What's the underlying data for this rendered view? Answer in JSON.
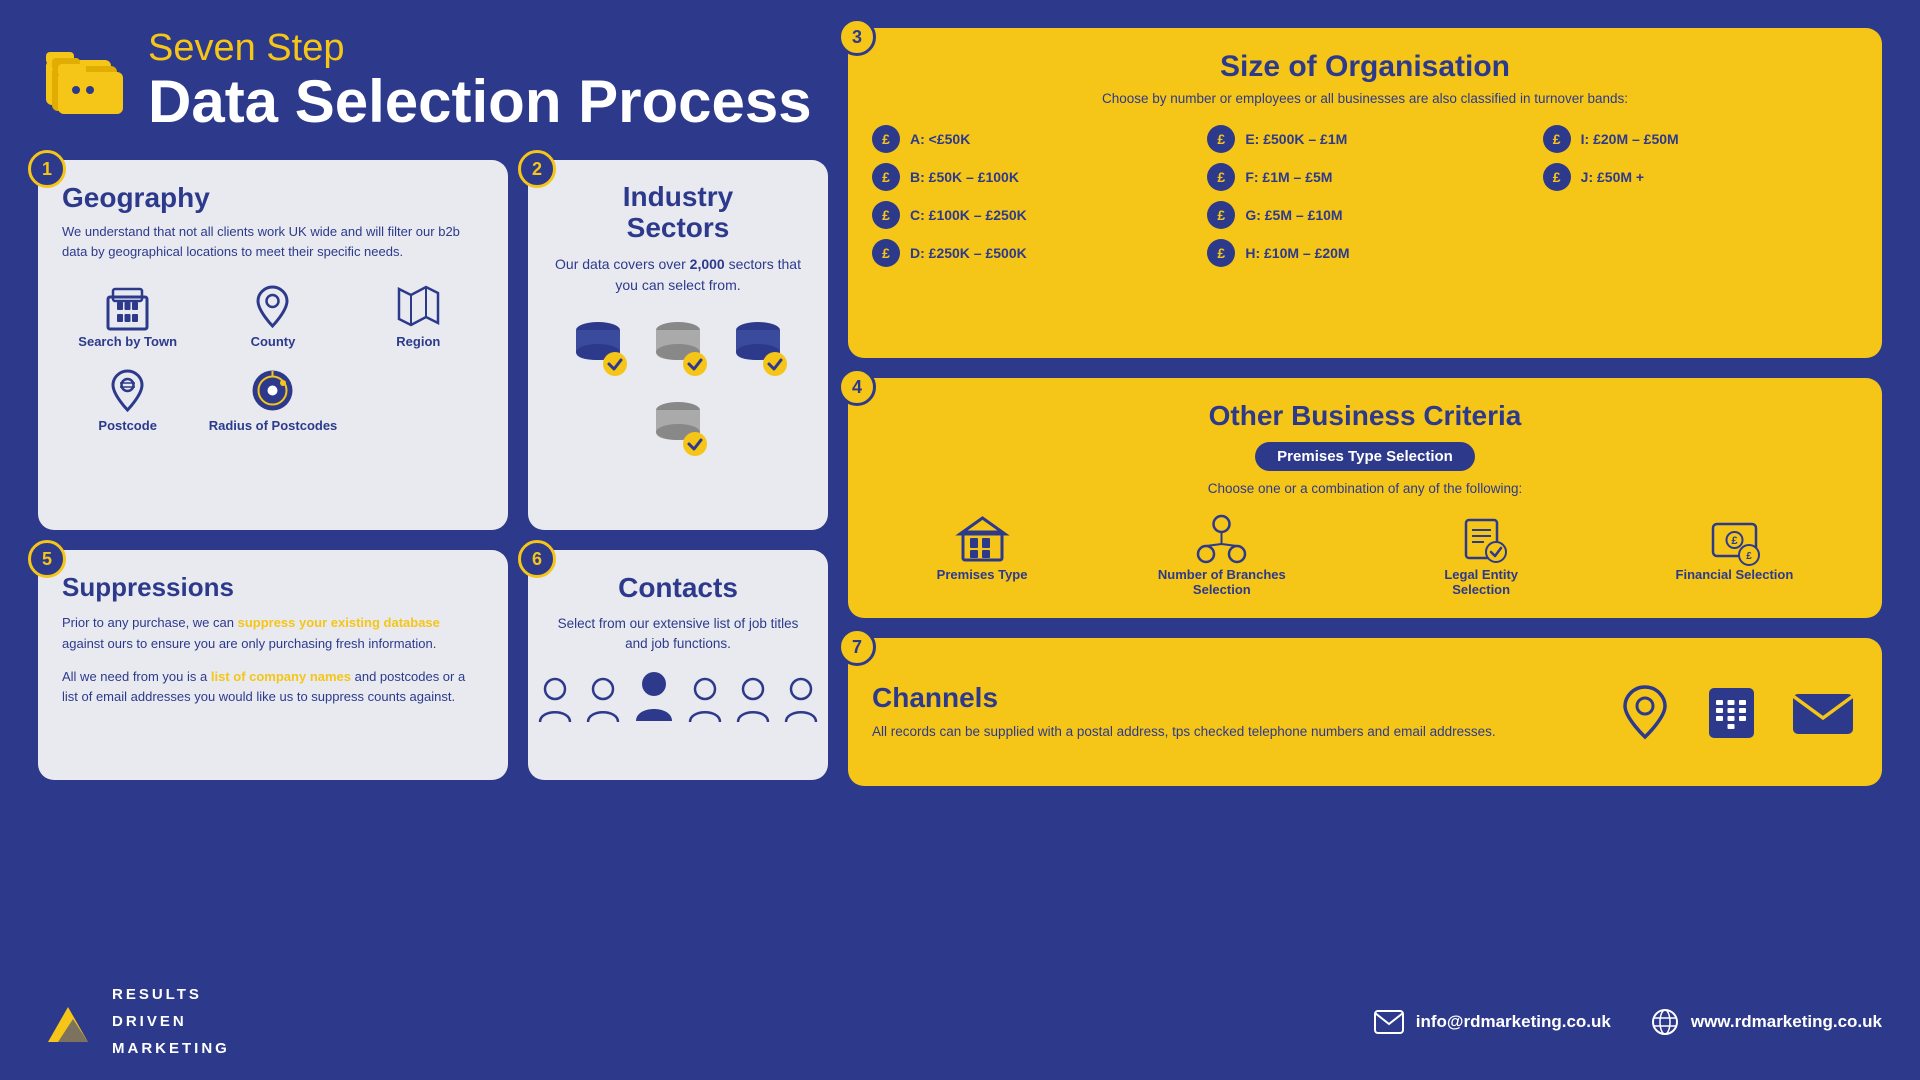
{
  "header": {
    "subtitle": "Seven Step",
    "title": "Data Selection Process",
    "icon": "folder-icon"
  },
  "steps": {
    "s1": {
      "number": "1",
      "title": "Geography",
      "body": "We understand that not all clients work UK wide and will filter our b2b data by geographical locations to meet their specific needs.",
      "icons": [
        {
          "label": "Search by Town",
          "icon": "building-icon"
        },
        {
          "label": "County",
          "icon": "pin-icon"
        },
        {
          "label": "Region",
          "icon": "map-icon"
        },
        {
          "label": "Postcode",
          "icon": "postcode-icon"
        },
        {
          "label": "Radius of Postcodes",
          "icon": "radius-icon"
        }
      ]
    },
    "s2": {
      "number": "2",
      "title": "Industry Sectors",
      "body": "Our data covers over 2,000 sectors that you can select from.",
      "bold": "2,000"
    },
    "s3": {
      "number": "3",
      "title": "Size of Organisation",
      "sub": "Choose by number or employees or all businesses are also classified in turnover bands:",
      "items": [
        {
          "label": "A: <£50K",
          "col": 1
        },
        {
          "label": "B: £50K – £100K",
          "col": 1
        },
        {
          "label": "C: £100K – £250K",
          "col": 1
        },
        {
          "label": "D: £250K – £500K",
          "col": 1
        },
        {
          "label": "E: £500K – £1M",
          "col": 2
        },
        {
          "label": "F: £1M – £5M",
          "col": 2
        },
        {
          "label": "G: £5M – £10M",
          "col": 2
        },
        {
          "label": "H: £10M – £20M",
          "col": 2
        },
        {
          "label": "I: £20M – £50M",
          "col": 3
        },
        {
          "label": "J: £50M +",
          "col": 3
        }
      ]
    },
    "s4": {
      "number": "4",
      "title": "Other Business Criteria",
      "badge": "Premises Type Selection",
      "sub": "Choose one or a combination of any of the following:",
      "icons": [
        {
          "label": "Premises Type",
          "icon": "premises-icon"
        },
        {
          "label": "Number of Branches Selection",
          "icon": "branches-icon"
        },
        {
          "label": "Legal Entity Selection",
          "icon": "legal-icon"
        },
        {
          "label": "Financial Selection",
          "icon": "financial-icon"
        }
      ]
    },
    "s5": {
      "number": "5",
      "title": "Suppressions",
      "body1": "Prior to any purchase, we can suppress your existing database against ours to ensure you are only purchasing fresh information.",
      "link": "suppress your existing database",
      "body2": "All we need from you is a list of company names and postcodes or a list of email addresses you would like us to suppress counts against.",
      "link2": "list of company names"
    },
    "s6": {
      "number": "6",
      "title": "Contacts",
      "body": "Select from our extensive list of job titles and job functions."
    },
    "s7": {
      "number": "7",
      "title": "Channels",
      "body": "All records can be supplied with a postal address, tps checked telephone numbers and email addresses."
    }
  },
  "footer": {
    "logo_lines": [
      "RESULTS",
      "DRIVEN",
      "MARKETING"
    ],
    "email": "info@rdmarketing.co.uk",
    "website": "www.rdmarketing.co.uk"
  }
}
